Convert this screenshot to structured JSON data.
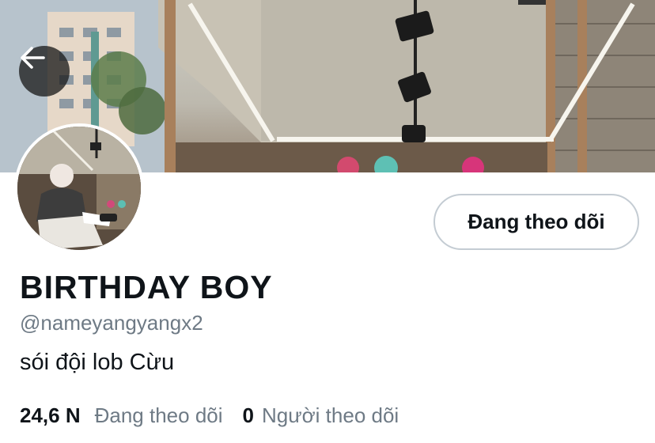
{
  "profile": {
    "display_name": "BIRTHDAY BOY",
    "handle": "@nameyangyangx2",
    "bio": "sói đội lob Cừu",
    "follow_button_label": "Đang theo dõi",
    "stats": {
      "following_count": "24,6 N",
      "following_label": "Đang theo dõi",
      "followers_count": "0",
      "followers_label": "Người theo dõi"
    }
  },
  "icons": {
    "back": "arrow-left-icon"
  },
  "colors": {
    "text_primary": "#0f1419",
    "text_secondary": "#6e7a85",
    "button_border": "#c4ccd3",
    "back_button_bg": "#1e1e1e"
  }
}
